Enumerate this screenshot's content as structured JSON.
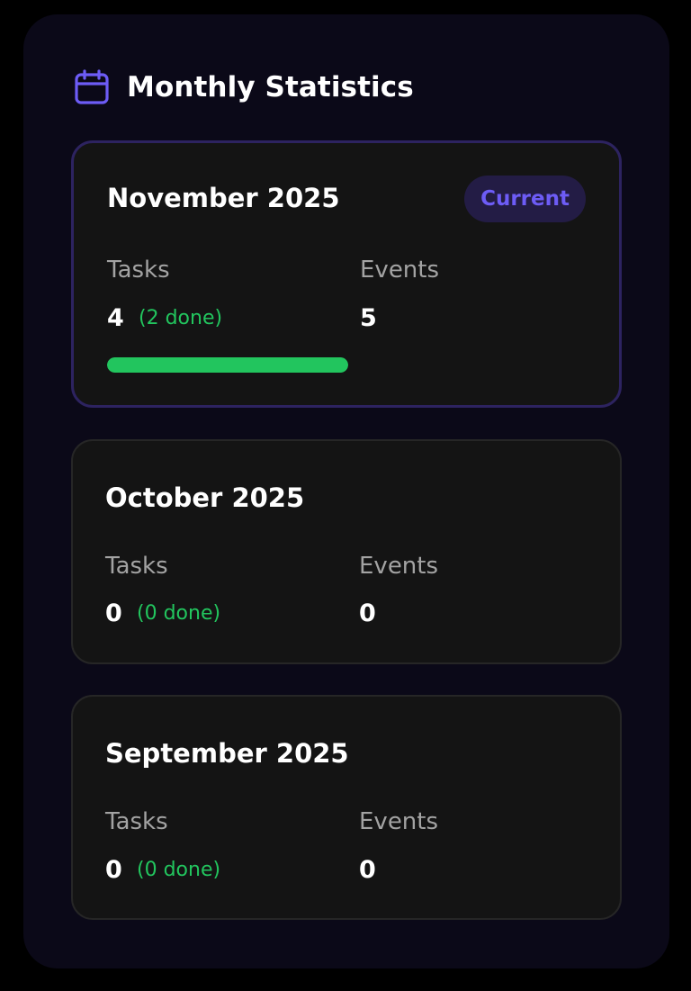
{
  "header": {
    "title": "Monthly Statistics",
    "icon": "calendar-icon"
  },
  "labels": {
    "tasks": "Tasks",
    "events": "Events"
  },
  "months": [
    {
      "name": "November 2025",
      "badge": "Current",
      "tasks": "4",
      "done": "(2 done)",
      "events": "5",
      "progress": 1.0
    },
    {
      "name": "October 2025",
      "tasks": "0",
      "done": "(0 done)",
      "events": "0"
    },
    {
      "name": "September 2025",
      "tasks": "0",
      "done": "(0 done)",
      "events": "0"
    }
  ],
  "colors": {
    "panel_bg": "#0b0918",
    "card_bg": "#141414",
    "accent": "#6d5cf6",
    "success": "#22c55e"
  }
}
